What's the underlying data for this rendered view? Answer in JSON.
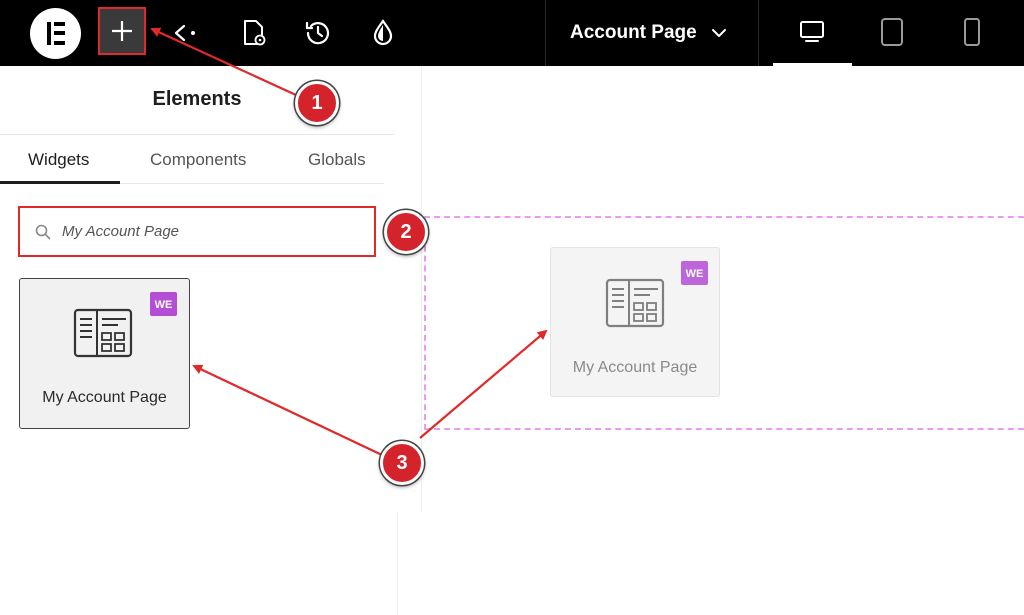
{
  "topbar": {
    "page_selector_label": "Account Page",
    "icons": [
      "elementor-logo-icon",
      "add-element-icon",
      "structure-icon",
      "page-settings-icon",
      "history-icon",
      "site-settings-icon"
    ],
    "devices": [
      "desktop-icon",
      "tablet-icon",
      "mobile-icon"
    ]
  },
  "panel": {
    "title": "Elements",
    "tabs": [
      {
        "label": "Widgets",
        "active": true
      },
      {
        "label": "Components",
        "active": false
      },
      {
        "label": "Globals",
        "active": false
      }
    ],
    "search": {
      "value": "My Account Page",
      "icon": "search-icon"
    },
    "widgets": [
      {
        "label": "My Account Page",
        "icon": "my-account-page-icon",
        "badge": "woocommerce-badge-icon"
      }
    ]
  },
  "canvas": {
    "dragging_widget_label": "My Account Page"
  },
  "annotations": {
    "callouts": [
      "1",
      "2",
      "3"
    ],
    "color": "#d5232b"
  },
  "colors": {
    "topbar_bg": "#000000",
    "highlight": "#e02a2a",
    "badge": "#b44ed6",
    "dropzone": "#ea9bef"
  }
}
